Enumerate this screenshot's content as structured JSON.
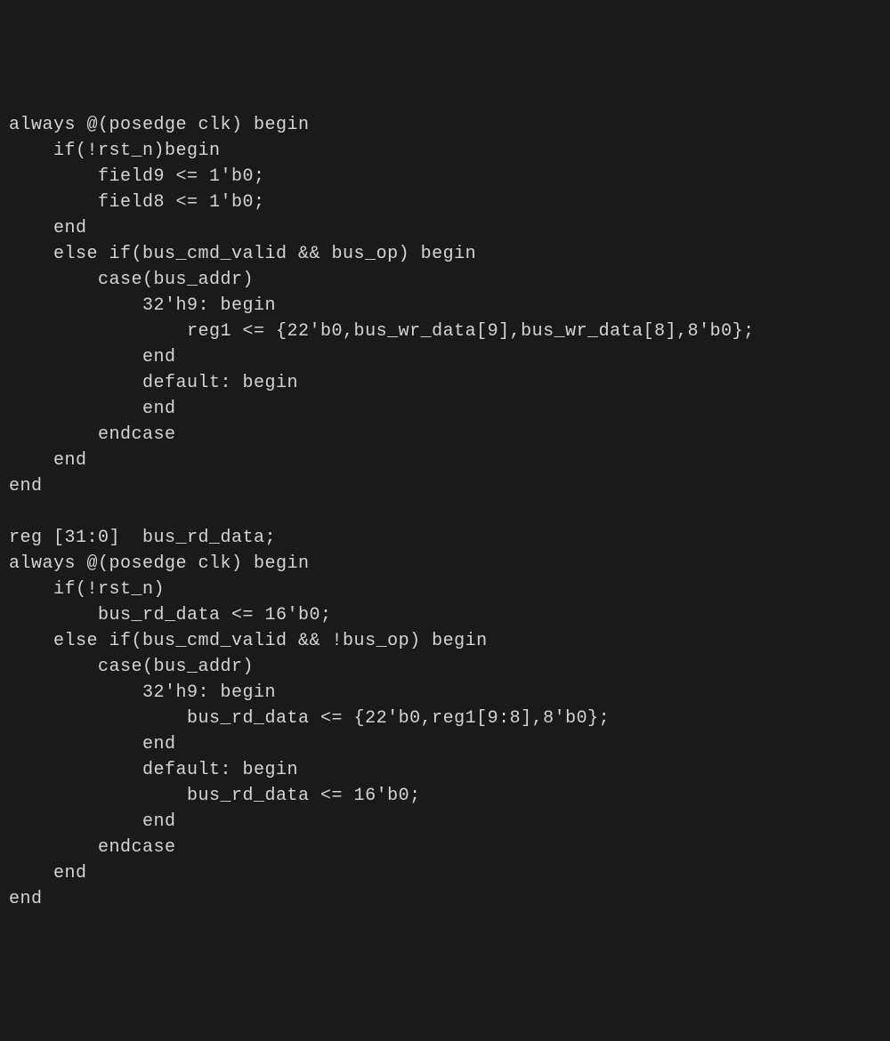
{
  "code": {
    "lines": [
      "always @(posedge clk) begin",
      "    if(!rst_n)begin",
      "        field9 <= 1'b0;",
      "        field8 <= 1'b0;",
      "    end",
      "    else if(bus_cmd_valid && bus_op) begin",
      "        case(bus_addr)",
      "            32'h9: begin",
      "                reg1 <= {22'b0,bus_wr_data[9],bus_wr_data[8],8'b0};",
      "            end",
      "            default: begin",
      "            end",
      "        endcase",
      "    end",
      "end",
      "",
      "reg [31:0]  bus_rd_data;",
      "always @(posedge clk) begin",
      "    if(!rst_n)",
      "        bus_rd_data <= 16'b0;",
      "    else if(bus_cmd_valid && !bus_op) begin",
      "        case(bus_addr)",
      "            32'h9: begin",
      "                bus_rd_data <= {22'b0,reg1[9:8],8'b0};",
      "            end",
      "            default: begin",
      "                bus_rd_data <= 16'b0;",
      "            end",
      "        endcase",
      "    end",
      "end"
    ]
  }
}
